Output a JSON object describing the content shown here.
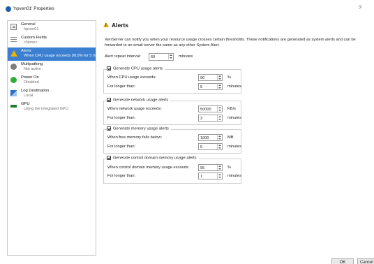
{
  "window": {
    "title": "'hpven01' Properties",
    "help": "?"
  },
  "sidebar": {
    "items": [
      {
        "title": "General",
        "subtitle": "hpven01",
        "icon": "general-icon"
      },
      {
        "title": "Custom Fields",
        "subtitle": "<None>",
        "icon": "custom-fields-icon"
      },
      {
        "title": "Alerts",
        "subtitle": "When CPU usage exceeds 90.0% for 5 m...",
        "icon": "alert-icon"
      },
      {
        "title": "Multipathing",
        "subtitle": "Not active",
        "icon": "multipathing-icon"
      },
      {
        "title": "Power On",
        "subtitle": "Disabled",
        "icon": "power-icon"
      },
      {
        "title": "Log Destination",
        "subtitle": "Local",
        "icon": "log-destination-icon"
      },
      {
        "title": "GPU",
        "subtitle": "Using the integrated GPU",
        "icon": "gpu-icon"
      }
    ]
  },
  "content": {
    "title": "Alerts",
    "description": "XenServer can notify you when your resource usage crosses certain thresholds. These notifications are generated as system alerts and can be forwarded  to an email server the same as any other System Alert.",
    "repeat": {
      "label": "Alert repeat interval:",
      "value": "60",
      "unit": "minutes"
    },
    "groups": {
      "cpu": {
        "legend": "Generate CPU usage alerts",
        "row1": {
          "label": "When CPU usage exceeds:",
          "value": "90",
          "unit": "%"
        },
        "row2": {
          "label": "For longer than:",
          "value": "5",
          "unit": "minutes"
        }
      },
      "network": {
        "legend": "Generate network usage alerts",
        "row1": {
          "label": "When network usage exceeds:",
          "value": "50000",
          "unit": "KB/s"
        },
        "row2": {
          "label": "For longer than:",
          "value": "3",
          "unit": "minutes"
        }
      },
      "memory": {
        "legend": "Generate memory usage alerts",
        "row1": {
          "label": "When free memory falls below:",
          "value": "1000",
          "unit": "MB"
        },
        "row2": {
          "label": "For longer than:",
          "value": "5",
          "unit": "minutes"
        }
      },
      "control": {
        "legend": "Generate control domain memory usage alerts",
        "row1": {
          "label": "When control domain memory usage exceeds:",
          "value": "95",
          "unit": "%"
        },
        "row2": {
          "label": "For longer than:",
          "value": "1",
          "unit": "minutes"
        }
      }
    }
  },
  "buttons": {
    "ok": "OK",
    "cancel": "Cancel"
  }
}
